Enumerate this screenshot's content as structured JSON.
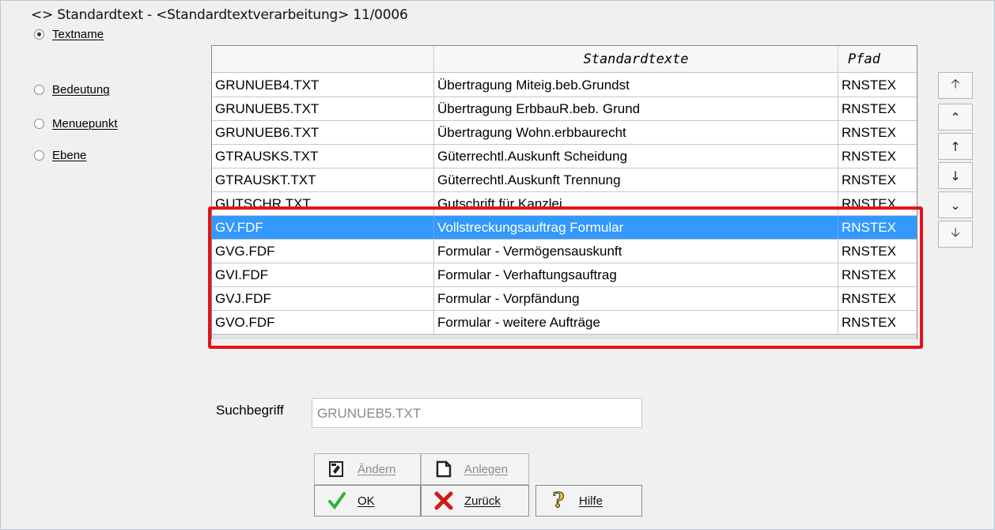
{
  "window": {
    "title": "<> Standardtext - <Standardtextverarbeitung> 11/0006"
  },
  "sort_options": [
    {
      "label": "Textname",
      "selected": true
    },
    {
      "label": "Bedeutung",
      "selected": false
    },
    {
      "label": "Menuepunkt",
      "selected": false
    },
    {
      "label": "Ebene",
      "selected": false
    }
  ],
  "table": {
    "headers": {
      "description": "Standardtexte",
      "path": "Pfad"
    },
    "rows": [
      {
        "name": "GRUNUEB4.TXT",
        "description": "Übertragung Miteig.beb.Grundst",
        "path": "RNSTEX"
      },
      {
        "name": "GRUNUEB5.TXT",
        "description": "Übertragung ErbbauR.beb. Grund",
        "path": "RNSTEX"
      },
      {
        "name": "GRUNUEB6.TXT",
        "description": "Übertragung Wohn.erbbaurecht",
        "path": "RNSTEX"
      },
      {
        "name": "GTRAUSKS.TXT",
        "description": "Güterrechtl.Auskunft Scheidung",
        "path": "RNSTEX"
      },
      {
        "name": "GTRAUSKT.TXT",
        "description": "Güterrechtl.Auskunft Trennung",
        "path": "RNSTEX"
      },
      {
        "name": "GUTSCHR.TXT",
        "description": "Gutschrift für Kanzlei",
        "path": "RNSTEX"
      },
      {
        "name": "GV.FDF",
        "description": "Vollstreckungsauftrag Formular",
        "path": "RNSTEX",
        "selected": true
      },
      {
        "name": "GVG.FDF",
        "description": "Formular - Vermögensauskunft",
        "path": "RNSTEX"
      },
      {
        "name": "GVI.FDF",
        "description": "Formular - Verhaftungsauftrag",
        "path": "RNSTEX"
      },
      {
        "name": "GVJ.FDF",
        "description": "Formular - Vorpfändung",
        "path": "RNSTEX"
      },
      {
        "name": "GVO.FDF",
        "description": "Formular - weitere Aufträge",
        "path": "RNSTEX"
      }
    ]
  },
  "nav_buttons": [
    {
      "icon": "arrow-first-icon",
      "glyph": "🡡"
    },
    {
      "icon": "page-up-icon",
      "glyph": "⌃"
    },
    {
      "icon": "arrow-up-icon",
      "glyph": "↑"
    },
    {
      "icon": "arrow-down-icon",
      "glyph": "↓"
    },
    {
      "icon": "page-down-icon",
      "glyph": "⌄"
    },
    {
      "icon": "arrow-last-icon",
      "glyph": "🡣"
    }
  ],
  "search": {
    "label": "Suchbegriff",
    "value": "GRUNUEB5.TXT"
  },
  "buttons": {
    "edit": "Ändern",
    "create": "Anlegen",
    "ok": "OK",
    "back": "Zurück",
    "help": "Hilfe"
  },
  "colors": {
    "selection": "#3399ff",
    "highlight_box": "#e0141a",
    "ok_check": "#2fb52f",
    "back_x": "#d11a1a",
    "help_q": "#e3c020"
  }
}
